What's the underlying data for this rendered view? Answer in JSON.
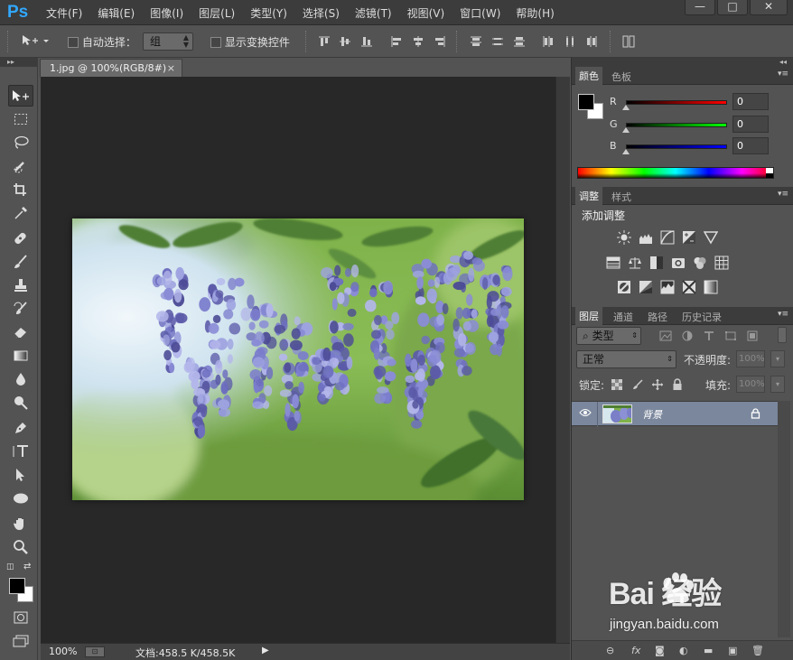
{
  "app": {
    "logo": "Ps",
    "menu": [
      "文件(F)",
      "编辑(E)",
      "图像(I)",
      "图层(L)",
      "类型(Y)",
      "选择(S)",
      "滤镜(T)",
      "视图(V)",
      "窗口(W)",
      "帮助(H)"
    ],
    "window_controls": {
      "minimize": "—",
      "restore": "□",
      "close": "✕"
    }
  },
  "options_bar": {
    "auto_select_label": "自动选择：",
    "auto_select_checked": false,
    "group_value": "组",
    "show_transform_label": "显示变换控件",
    "show_transform_checked": false
  },
  "document": {
    "tab_title": "1.jpg @ 100%(RGB/8#)",
    "tab_close": "×",
    "image_subject": "wisteria flowers photo"
  },
  "status_bar": {
    "zoom": "100%",
    "doc_size": "文档:458.5 K/458.5K",
    "arrow": "▶"
  },
  "tools": [
    "move-icon",
    "marquee-icon",
    "lasso-icon",
    "quick-select-icon",
    "crop-icon",
    "eyedropper-icon",
    "healing-icon",
    "brush-icon",
    "stamp-icon",
    "history-brush-icon",
    "eraser-icon",
    "gradient-icon",
    "blur-icon",
    "dodge-icon",
    "pen-icon",
    "type-icon",
    "path-select-icon",
    "ellipse-icon",
    "hand-icon",
    "zoom-icon",
    "quick-mask-icon",
    "screen-mode-icon"
  ],
  "colors_panel": {
    "tabs": [
      "颜色",
      "色板"
    ],
    "r_label": "R",
    "r_value": "0",
    "g_label": "G",
    "g_value": "0",
    "b_label": "B",
    "b_value": "0",
    "foreground": "#000000",
    "background": "#ffffff"
  },
  "adjustments_panel": {
    "tabs": [
      "调整",
      "样式"
    ],
    "title": "添加调整"
  },
  "layers_panel": {
    "tabs": [
      "图层",
      "通道",
      "路径",
      "历史记录"
    ],
    "kind_filter": "类型",
    "blend_mode": "正常",
    "opacity_label": "不透明度:",
    "opacity_value": "100%",
    "lock_label": "锁定:",
    "fill_label": "填充:",
    "fill_value": "100%",
    "layers": [
      {
        "name": "背景",
        "visible": true,
        "locked": true
      }
    ]
  },
  "watermark": {
    "line1": "Bai  经验",
    "line2": "jingyan.baidu.com"
  }
}
